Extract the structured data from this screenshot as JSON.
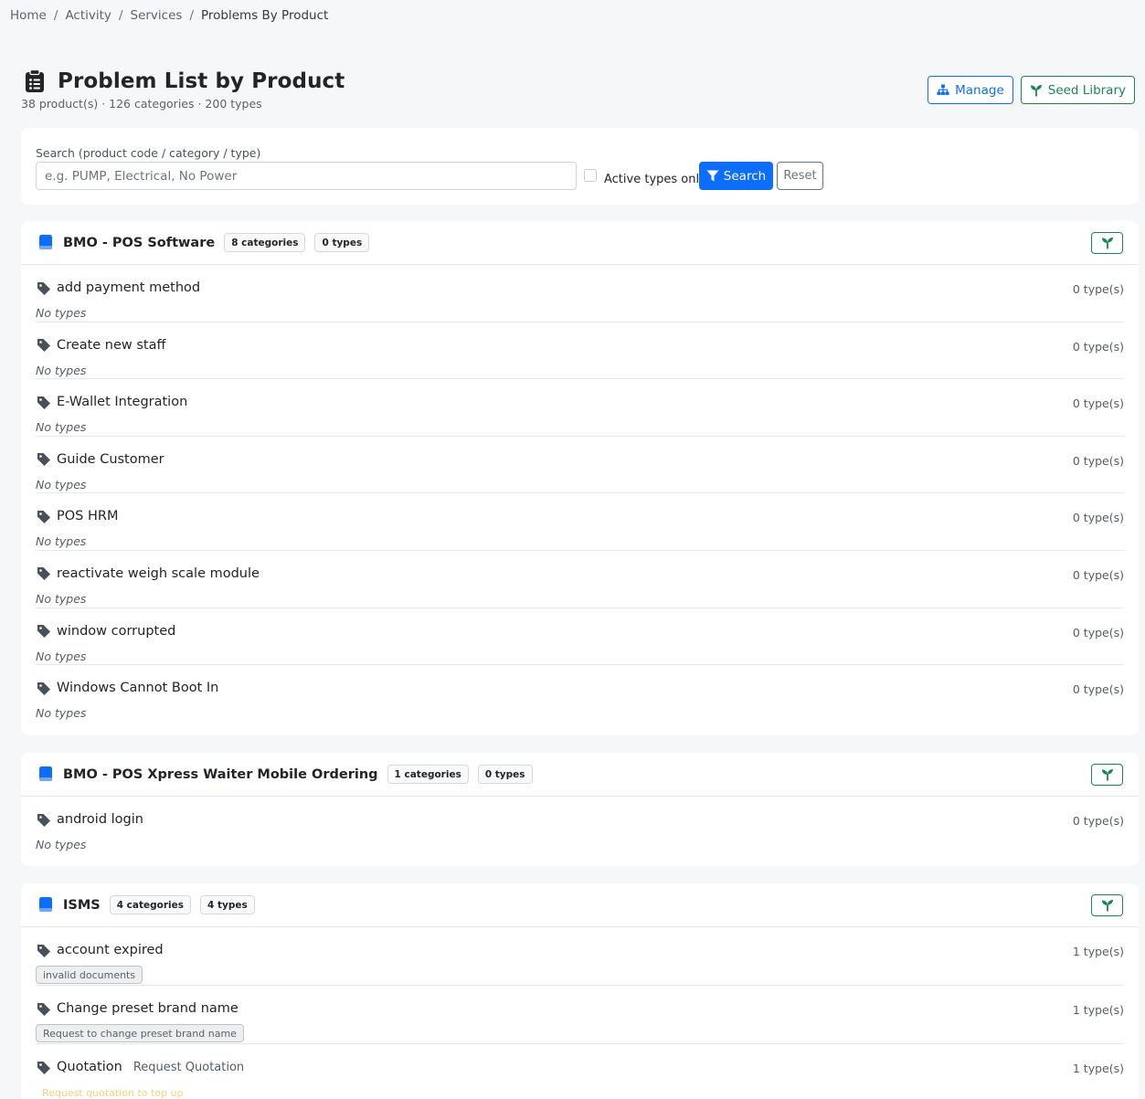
{
  "breadcrumb": {
    "items": [
      "Home",
      "Activity",
      "Services"
    ],
    "current": "Problems By Product",
    "separator": "/"
  },
  "header": {
    "title": "Problem List by Product",
    "subtitle": "38 product(s) · 126 categories · 200 types",
    "title_icon": "clipboard-list-icon",
    "manage_label": "Manage",
    "seed_label": "Seed Library"
  },
  "search": {
    "label": "Search (product code / category / type)",
    "placeholder": "e.g. PUMP, Electrical, No Power",
    "value": "",
    "active_only_label": "Active types only",
    "active_only_checked": false,
    "search_label": "Search",
    "reset_label": "Reset"
  },
  "colors": {
    "primary": "#0d6efd",
    "success": "#198754",
    "background": "#f6f7f9",
    "warning_text": "#f3d27a"
  },
  "products": [
    {
      "name": "BMO - POS Software",
      "categories_badge": "8 categories",
      "types_badge": "0 types",
      "categories": [
        {
          "name": "add payment method",
          "count": "0 type(s)",
          "empty_text": "No types"
        },
        {
          "name": "Create new staff",
          "count": "0 type(s)",
          "empty_text": "No types"
        },
        {
          "name": "E-Wallet Integration",
          "count": "0 type(s)",
          "empty_text": "No types"
        },
        {
          "name": "Guide Customer",
          "count": "0 type(s)",
          "empty_text": "No types"
        },
        {
          "name": "POS HRM",
          "count": "0 type(s)",
          "empty_text": "No types"
        },
        {
          "name": "reactivate weigh scale module",
          "count": "0 type(s)",
          "empty_text": "No types"
        },
        {
          "name": "window corrupted",
          "count": "0 type(s)",
          "empty_text": "No types"
        },
        {
          "name": "Windows Cannot Boot In",
          "count": "0 type(s)",
          "empty_text": "No types"
        }
      ]
    },
    {
      "name": "BMO - POS Xpress Waiter Mobile Ordering",
      "categories_badge": "1 categories",
      "types_badge": "0 types",
      "categories": [
        {
          "name": "android login",
          "count": "0 type(s)",
          "empty_text": "No types"
        }
      ]
    },
    {
      "name": "ISMS",
      "categories_badge": "4 categories",
      "types_badge": "4 types",
      "categories": [
        {
          "name": "account expired",
          "count": "1 type(s)",
          "type": "invalid documents"
        },
        {
          "name": "Change preset brand name",
          "count": "1 type(s)",
          "type": "Request to change preset brand name"
        },
        {
          "name": "Quotation",
          "desc": "Request Quotation",
          "count": "1 type(s)",
          "type": "Request quotation to top up"
        }
      ]
    }
  ]
}
